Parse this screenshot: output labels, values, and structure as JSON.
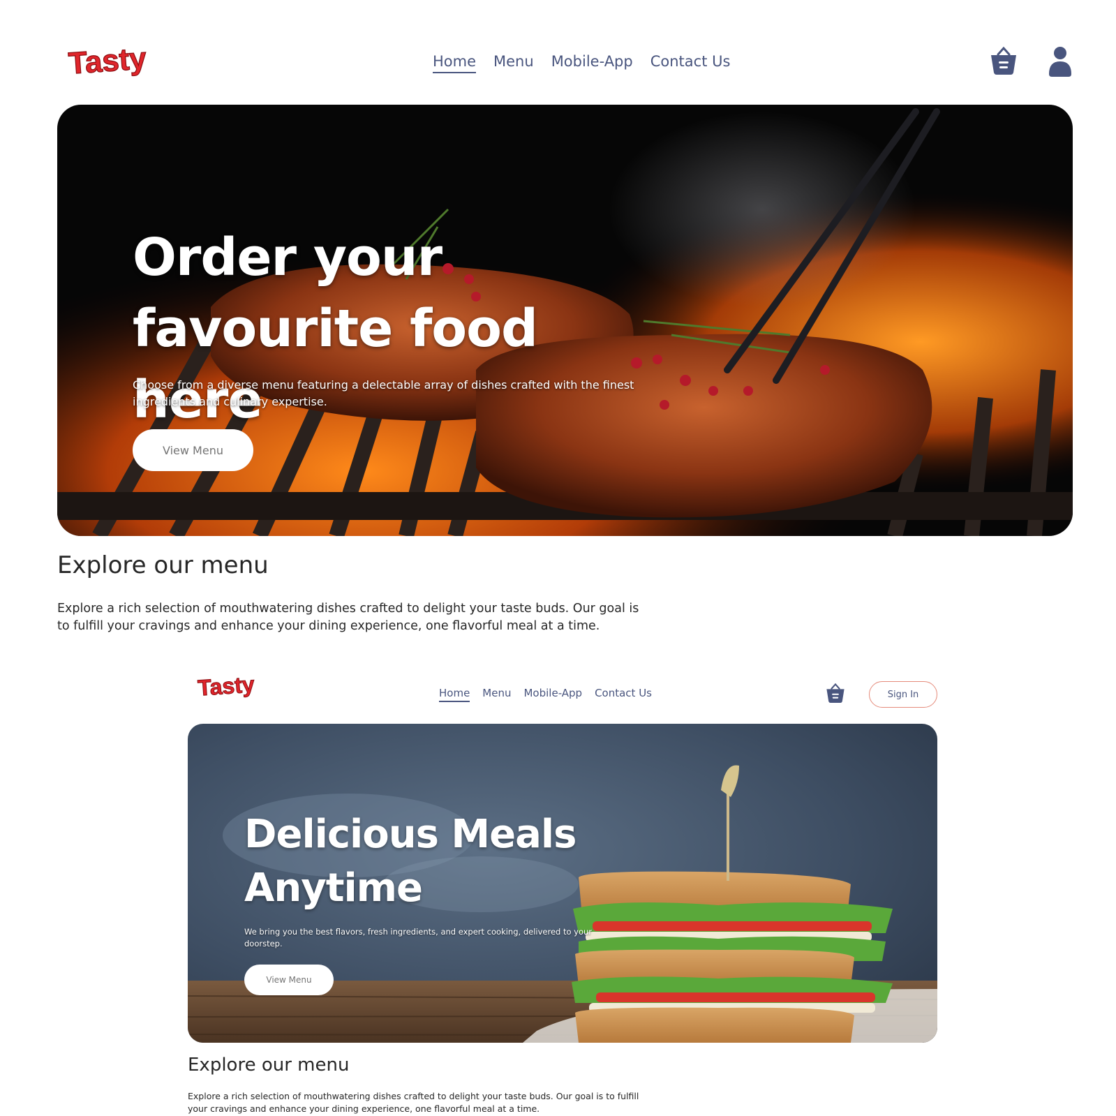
{
  "brand": {
    "logo_text": "Tasty",
    "logo_color": "#e0252b"
  },
  "colors": {
    "nav_text": "#49557e",
    "signin_border": "#e58a7a",
    "button_text": "#747474",
    "heading_text": "#262626"
  },
  "screen1": {
    "nav": {
      "items": [
        {
          "label": "Home",
          "active": true
        },
        {
          "label": "Menu",
          "active": false
        },
        {
          "label": "Mobile-App",
          "active": false
        },
        {
          "label": "Contact Us",
          "active": false
        }
      ],
      "basket_icon": "basket-icon",
      "profile_icon": "user-profile-icon"
    },
    "hero": {
      "title": "Order your favourite food here",
      "description": "Choose from a diverse menu featuring a delectable array of dishes crafted with the finest ingredients and culinary expertise.",
      "button_label": "View Menu",
      "image": "grilled-steaks-on-fire"
    },
    "explore": {
      "title": "Explore our menu",
      "description": "Explore a rich selection of mouthwatering dishes crafted to delight your taste buds. Our goal is to fulfill your cravings and enhance your dining experience, one flavorful meal at a time."
    }
  },
  "screen2": {
    "nav": {
      "items": [
        {
          "label": "Home",
          "active": true
        },
        {
          "label": "Menu",
          "active": false
        },
        {
          "label": "Mobile-App",
          "active": false
        },
        {
          "label": "Contact Us",
          "active": false
        }
      ],
      "basket_icon": "basket-icon",
      "signin_label": "Sign In"
    },
    "hero": {
      "title": "Delicious Meals Anytime",
      "description": "We bring you the best flavors, fresh ingredients, and expert cooking, delivered to your doorstep.",
      "button_label": "View Menu",
      "image": "club-sandwich-on-slate"
    },
    "explore": {
      "title": "Explore our menu",
      "description": "Explore a rich selection of mouthwatering dishes crafted to delight your taste buds. Our goal is to fulfill your cravings and enhance your dining experience, one flavorful meal at a time."
    }
  }
}
